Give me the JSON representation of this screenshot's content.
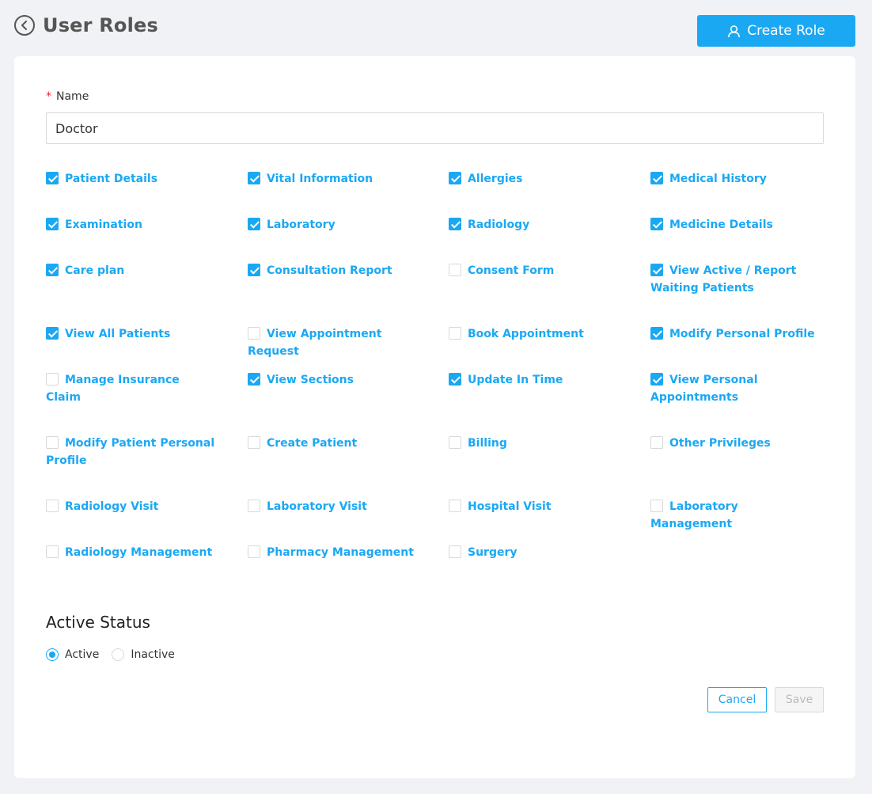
{
  "header": {
    "title": "User Roles",
    "create_label": "Create Role"
  },
  "form": {
    "name_label": "Name",
    "required_mark": "*",
    "name_value": "Doctor",
    "permissions": [
      {
        "label": "Patient Details",
        "checked": true
      },
      {
        "label": "Vital Information",
        "checked": true
      },
      {
        "label": "Allergies",
        "checked": true
      },
      {
        "label": "Medical History",
        "checked": true
      },
      {
        "label": "Examination",
        "checked": true
      },
      {
        "label": "Laboratory",
        "checked": true
      },
      {
        "label": "Radiology",
        "checked": true
      },
      {
        "label": "Medicine Details",
        "checked": true
      },
      {
        "label": "Care plan",
        "checked": true
      },
      {
        "label": "Consultation Report",
        "checked": true
      },
      {
        "label": "Consent Form",
        "checked": false
      },
      {
        "label": "View Active / Report Waiting Patients",
        "checked": true
      },
      {
        "label": "View All Patients",
        "checked": true
      },
      {
        "label": "View Appointment Request",
        "checked": false
      },
      {
        "label": "Book Appointment",
        "checked": false
      },
      {
        "label": "Modify Personal Profile",
        "checked": true
      },
      {
        "label": "Manage Insurance Claim",
        "checked": false
      },
      {
        "label": "View Sections",
        "checked": true
      },
      {
        "label": "Update In Time",
        "checked": true
      },
      {
        "label": "View Personal Appointments",
        "checked": true
      },
      {
        "label": "Modify Patient Personal Profile",
        "checked": false
      },
      {
        "label": "Create Patient",
        "checked": false
      },
      {
        "label": "Billing",
        "checked": false
      },
      {
        "label": "Other Privileges",
        "checked": false
      },
      {
        "label": "Radiology Visit",
        "checked": false
      },
      {
        "label": "Laboratory Visit",
        "checked": false
      },
      {
        "label": "Hospital Visit",
        "checked": false
      },
      {
        "label": "Laboratory Management",
        "checked": false
      },
      {
        "label": "Radiology Management",
        "checked": false
      },
      {
        "label": "Pharmacy Management",
        "checked": false
      },
      {
        "label": "Surgery",
        "checked": false
      }
    ],
    "status_title": "Active Status",
    "status_options": [
      {
        "label": "Active",
        "selected": true
      },
      {
        "label": "Inactive",
        "selected": false
      }
    ],
    "cancel_label": "Cancel",
    "save_label": "Save"
  },
  "colors": {
    "accent": "#1ba8f3",
    "background": "#f0f2f5",
    "required": "#f5222d"
  }
}
